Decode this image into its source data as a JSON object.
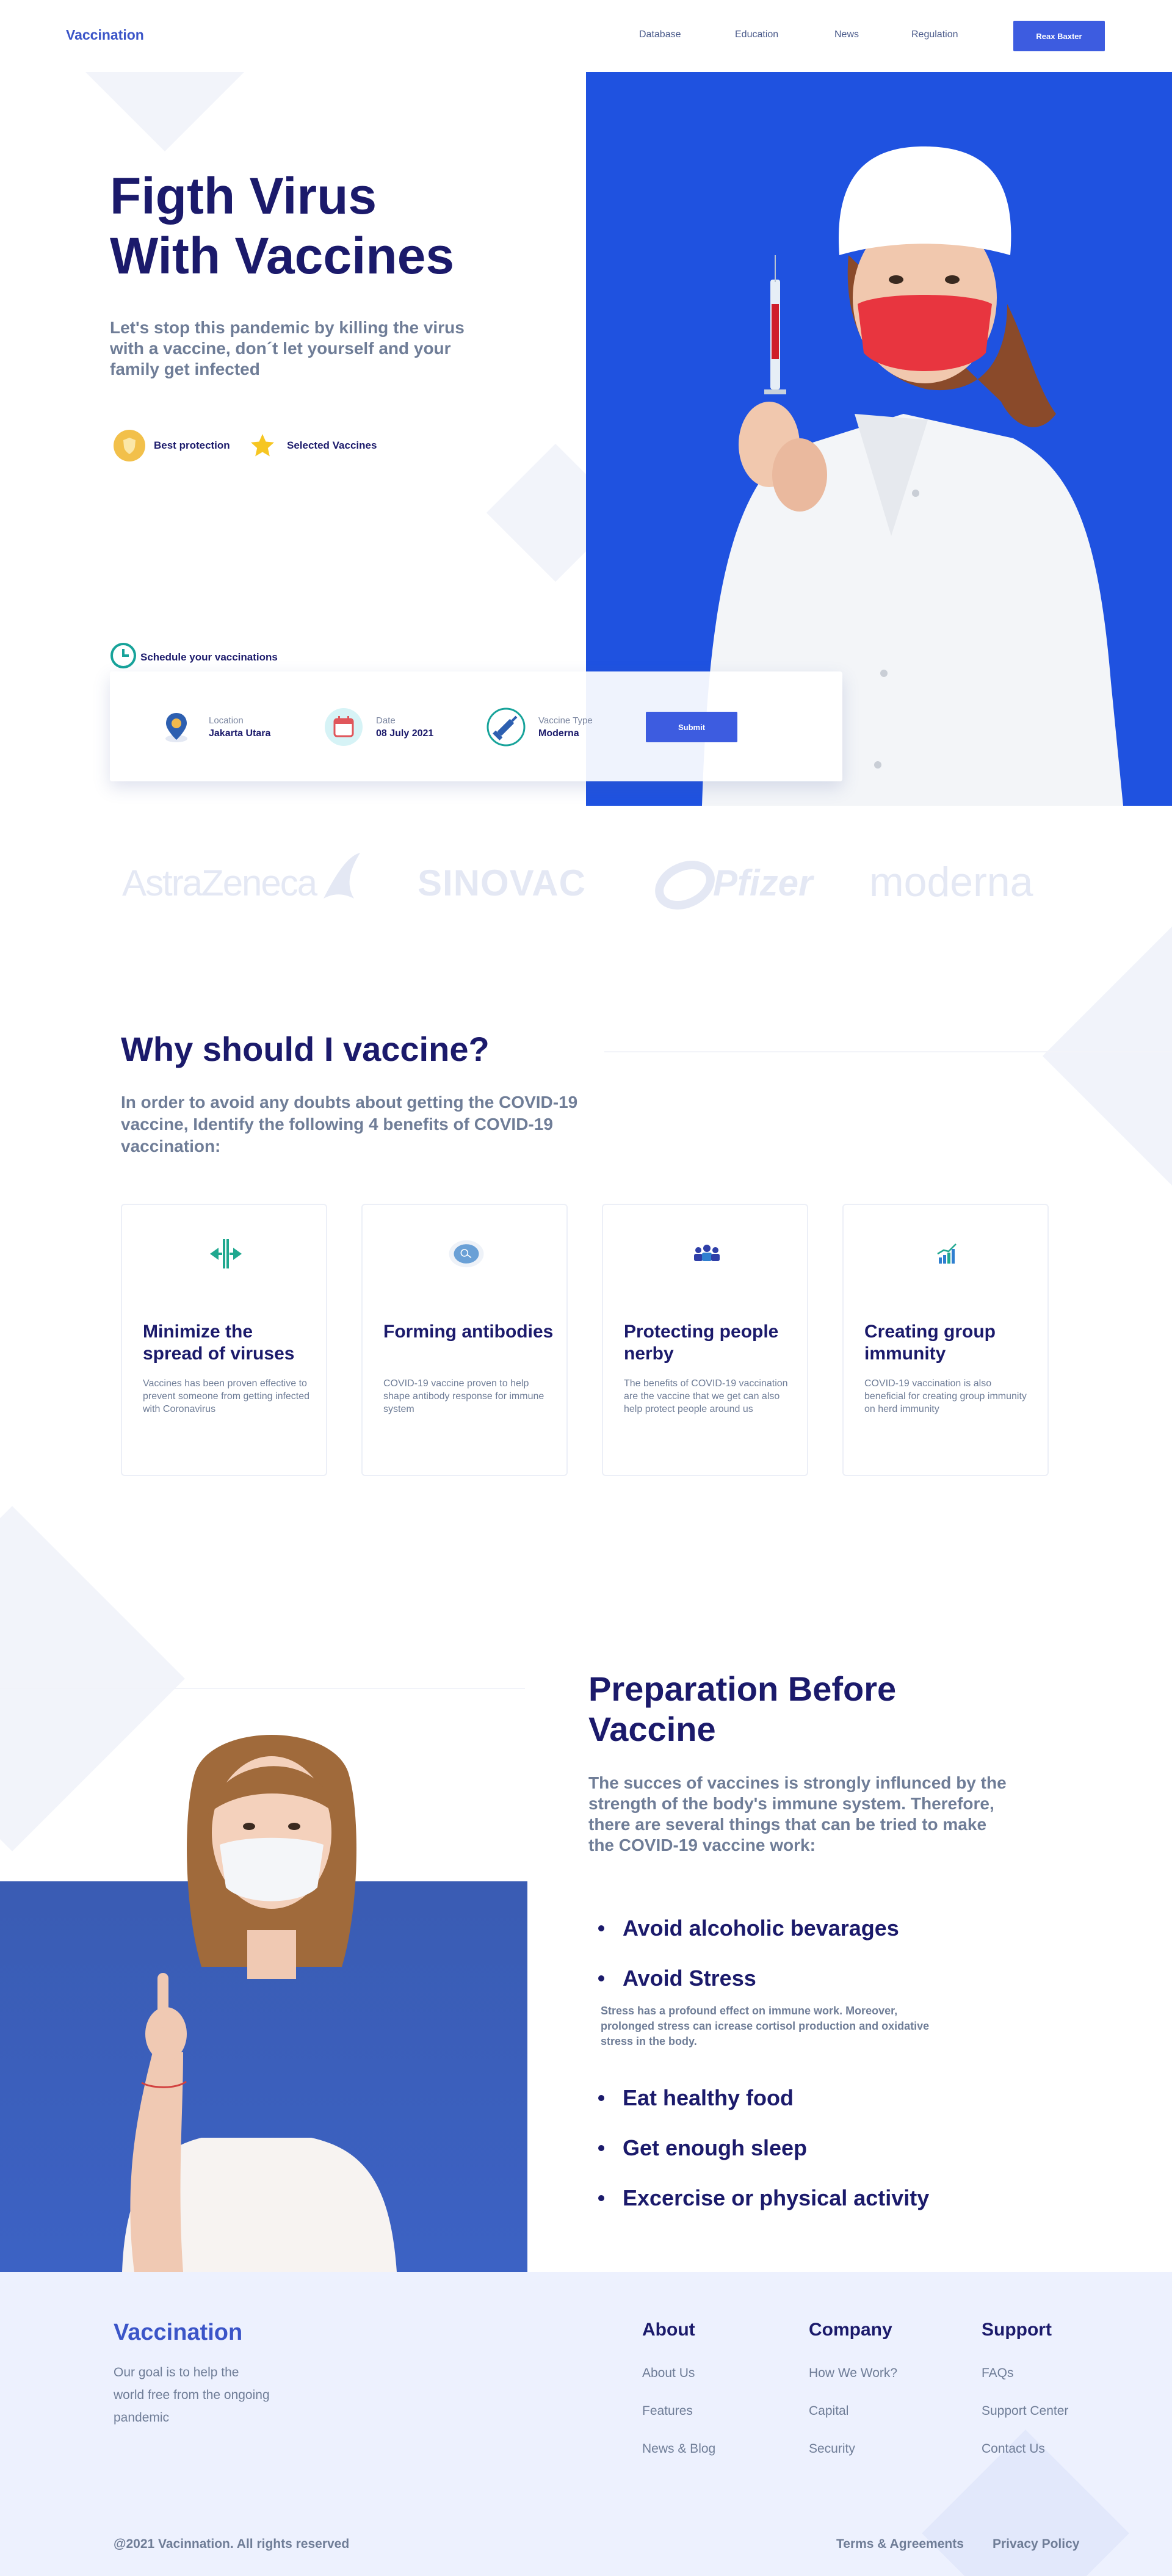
{
  "nav": {
    "logo": "Vaccination",
    "links": [
      "Database",
      "Education",
      "News",
      "Regulation"
    ],
    "cta": "Reax Baxter"
  },
  "hero": {
    "title": "Figth Virus\nWith Vaccines",
    "subtitle": "Let's stop this pandemic by killing the virus with a vaccine, don´t let yourself and your family get infected",
    "badges": [
      "Best protection",
      "Selected Vaccines"
    ],
    "schedule": {
      "label": "Schedule your vaccinations",
      "location_label": "Location",
      "location_value": "Jakarta Utara",
      "date_label": "Date",
      "date_value": "08 July 2021",
      "type_label": "Vaccine Type",
      "type_value": "Moderna",
      "submit": "Submit"
    }
  },
  "brands": [
    "AstraZeneca",
    "SINOVAC",
    "Pfizer",
    "moderna"
  ],
  "why": {
    "title": "Why should I vaccine?",
    "subtitle": "In order to avoid any doubts about getting the COVID-19 vaccine, Identify the following 4 benefits of COVID-19 vaccination:",
    "cards": [
      {
        "title": "Minimize the spread of viruses",
        "text": "Vaccines has been proven effective to prevent someone from getting infected with Coronavirus",
        "icon": "arrows-inward-icon"
      },
      {
        "title": "Forming antibodies",
        "text": "COVID-19 vaccine proven to help shape antibody response for immune system",
        "icon": "antibody-icon"
      },
      {
        "title": "Protecting people nerby",
        "text": "The benefits of COVID-19 vaccination are the vaccine that we get can also help protect people around us",
        "icon": "people-group-icon"
      },
      {
        "title": "Creating group immunity",
        "text": "COVID-19 vaccination is also beneficial for creating group immunity on herd immunity",
        "icon": "growth-chart-icon"
      }
    ]
  },
  "prep": {
    "title": "Preparation Before Vaccine",
    "subtitle": "The succes of vaccines is strongly influnced by the strength of the body's immune system. Therefore, there are several things that can be tried to make the COVID-19 vaccine work:",
    "items": [
      "Avoid alcoholic bevarages",
      "Avoid Stress",
      "Eat healthy food",
      "Get enough sleep",
      "Excercise or physical activity"
    ],
    "stress_note": "Stress has a profound effect on immune work. Moreover, prolonged stress can icrease cortisol production and oxidative stress in the body."
  },
  "footer": {
    "logo": "Vaccination",
    "desc": "Our goal is to help the world free from the ongoing pandemic",
    "about": {
      "title": "About",
      "links": [
        "About Us",
        "Features",
        "News & Blog"
      ]
    },
    "company": {
      "title": "Company",
      "links": [
        "How We Work?",
        "Capital",
        "Security"
      ]
    },
    "support": {
      "title": "Support",
      "links": [
        "FAQs",
        "Support Center",
        "Contact Us"
      ]
    },
    "copyright": "@2021 Vacinnation. All rights reserved",
    "terms": "Terms & Agreements",
    "privacy": "Privacy Policy"
  },
  "colors": {
    "brand": "#3b55c8",
    "navy": "#1b1a6b",
    "hero_blue": "#1f52e0",
    "muted": "#6f7d97",
    "footer_bg": "#edf1fe"
  }
}
